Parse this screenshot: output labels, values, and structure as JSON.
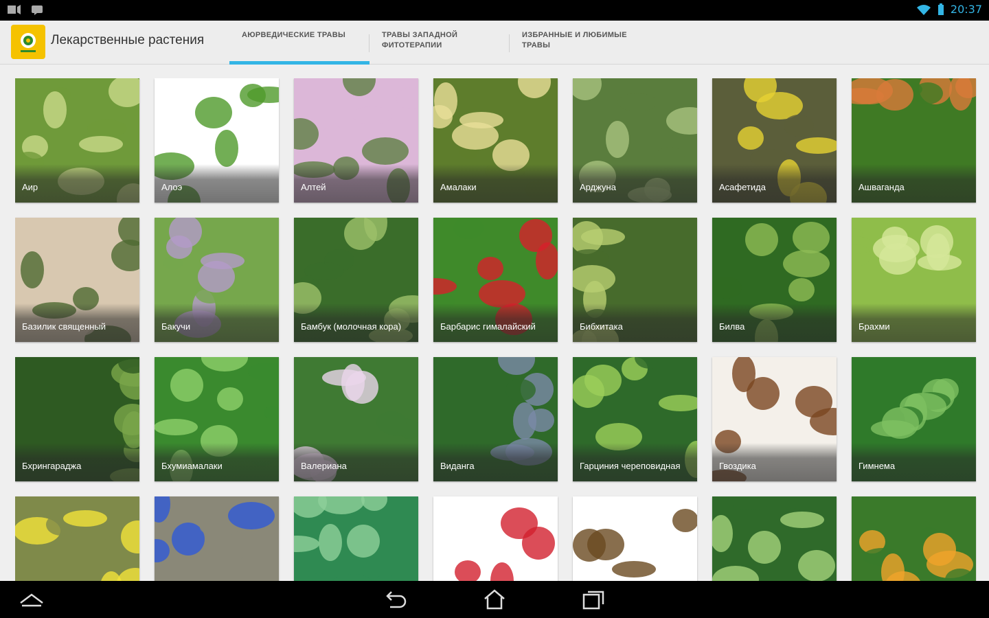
{
  "statusbar": {
    "time": "20:37"
  },
  "app": {
    "title": "Лекарственные растения",
    "accent": "#33b5e5"
  },
  "tabs": [
    {
      "label": "Аюрведические травы",
      "active": true
    },
    {
      "label": "Травы западной фитотерапии",
      "active": false
    },
    {
      "label": "Избранные и любимые травы",
      "active": false
    }
  ],
  "herbs": [
    {
      "label": "Аир",
      "colors": [
        "#6f9a3a",
        "#c9d98a"
      ]
    },
    {
      "label": "Алоэ",
      "colors": [
        "#ffffff",
        "#4f9a2a"
      ]
    },
    {
      "label": "Алтей",
      "colors": [
        "#dcb7d8",
        "#5f7f45"
      ]
    },
    {
      "label": "Амалаки",
      "colors": [
        "#5e7d2c",
        "#e8df98"
      ]
    },
    {
      "label": "Арджуна",
      "colors": [
        "#5a7d3d",
        "#a8c27e"
      ]
    },
    {
      "label": "Асафетида",
      "colors": [
        "#5b5e3a",
        "#e6d233"
      ]
    },
    {
      "label": "Ашваганда",
      "colors": [
        "#3f7a24",
        "#d97a3a"
      ]
    },
    {
      "label": "Базилик священный",
      "colors": [
        "#d8c8b0",
        "#4f6a32"
      ]
    },
    {
      "label": "Бакучи",
      "colors": [
        "#76a74c",
        "#b49bc9"
      ]
    },
    {
      "label": "Бамбук (молочная кора)",
      "colors": [
        "#3a6d2a",
        "#9ec06a"
      ]
    },
    {
      "label": "Барбарис гималайский",
      "colors": [
        "#3f8a2a",
        "#d6202a"
      ]
    },
    {
      "label": "Бибхитака",
      "colors": [
        "#476b2c",
        "#b9cf72"
      ]
    },
    {
      "label": "Билва",
      "colors": [
        "#2f6a22",
        "#8fbb55"
      ]
    },
    {
      "label": "Брахми",
      "colors": [
        "#8fbd4a",
        "#d6e79a"
      ]
    },
    {
      "label": "Бхрингараджа",
      "colors": [
        "#2e5a22",
        "#7aa64a"
      ]
    },
    {
      "label": "Бхумиамалаки",
      "colors": [
        "#3a8a2e",
        "#8fcf6a"
      ]
    },
    {
      "label": "Валериана",
      "colors": [
        "#3f7a33",
        "#ead6ea"
      ]
    },
    {
      "label": "Виданга",
      "colors": [
        "#2f6a2a",
        "#7a8aa8"
      ]
    },
    {
      "label": "Гарциния череповидная",
      "colors": [
        "#2e6a2a",
        "#9ccf5a"
      ]
    },
    {
      "label": "Гвоздика",
      "colors": [
        "#f4f0ea",
        "#7a4620"
      ]
    },
    {
      "label": "Гимнема",
      "colors": [
        "#2f7a2a",
        "#7ec062"
      ]
    },
    {
      "label": "",
      "colors": [
        "#7f8a4a",
        "#f2e23a"
      ]
    },
    {
      "label": "",
      "colors": [
        "#8a8878",
        "#2f5ad6"
      ]
    },
    {
      "label": "",
      "colors": [
        "#2f8a52",
        "#8fd09a"
      ]
    },
    {
      "label": "",
      "colors": [
        "#ffffff",
        "#d2202e"
      ]
    },
    {
      "label": "",
      "colors": [
        "#ffffff",
        "#6a4a20"
      ]
    },
    {
      "label": "",
      "colors": [
        "#2f6a2a",
        "#a4d27a"
      ]
    },
    {
      "label": "",
      "colors": [
        "#3a7a2a",
        "#f0a42a"
      ]
    }
  ]
}
